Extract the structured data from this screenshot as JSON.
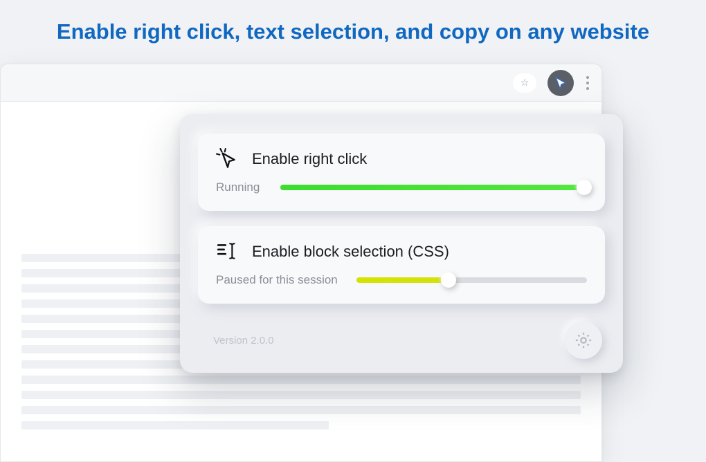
{
  "headline": "Enable right click, text selection, and copy on any website",
  "popup": {
    "card1": {
      "title": "Enable right click",
      "status": "Running",
      "slider_percent": 99,
      "fill_color": "#4be03a"
    },
    "card2": {
      "title": "Enable block selection (CSS)",
      "status": "Paused for this session",
      "slider_percent": 40,
      "fill_color": "#d4e200"
    },
    "version": "Version 2.0.0"
  },
  "icons": {
    "cursor_click": "cursor-click-icon",
    "text_select": "text-select-icon",
    "gear": "gear-icon",
    "extension": "extension-cursor-icon",
    "star": "star-icon",
    "kebab": "kebab-menu-icon"
  }
}
